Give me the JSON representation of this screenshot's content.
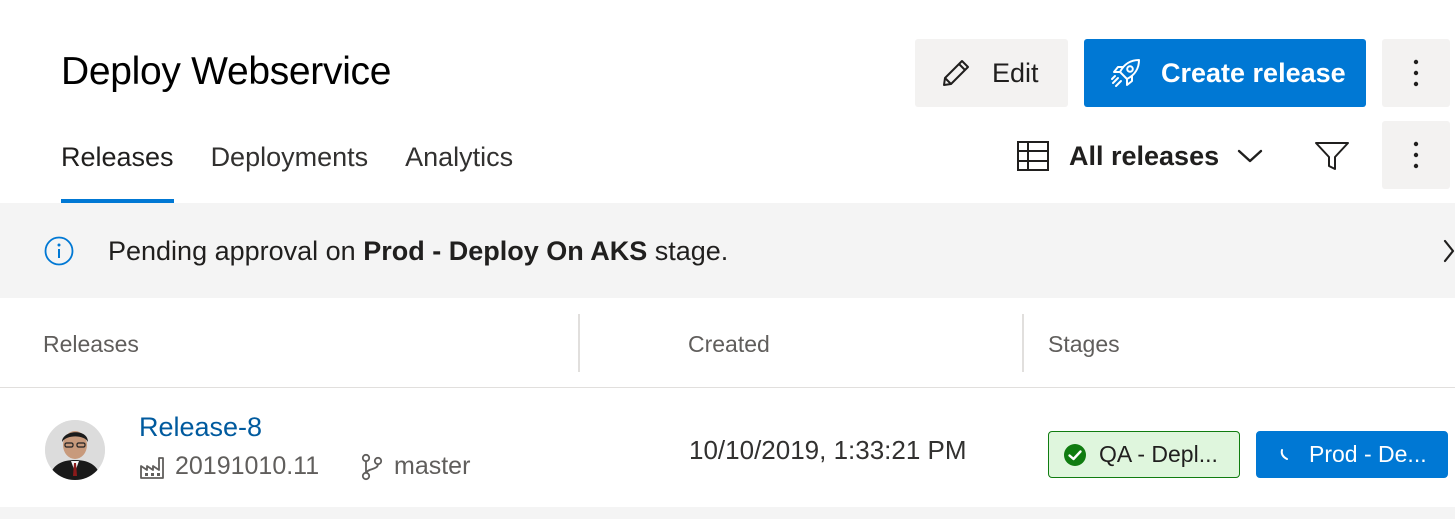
{
  "header": {
    "title": "Deploy Webservice",
    "edit_label": "Edit",
    "create_release_label": "Create release"
  },
  "tabs": [
    {
      "label": "Releases",
      "active": true
    },
    {
      "label": "Deployments",
      "active": false
    },
    {
      "label": "Analytics",
      "active": false
    }
  ],
  "toolbar": {
    "view_label": "All releases"
  },
  "banner": {
    "prefix": "Pending approval on ",
    "stage_name": "Prod - Deploy On AKS",
    "suffix": " stage."
  },
  "table": {
    "columns": [
      "Releases",
      "Created",
      "Stages"
    ],
    "rows": [
      {
        "release": "Release-8",
        "build": "20191010.11",
        "branch": "master",
        "created": "10/10/2019, 1:33:21 PM",
        "stages": [
          {
            "label": "QA - Depl...",
            "status": "succeeded"
          },
          {
            "label": "Prod - De...",
            "status": "in-progress"
          }
        ]
      }
    ]
  },
  "icons": {
    "edit": "pencil-icon",
    "create": "rocket-icon",
    "more": "more-vertical-icon",
    "view": "grid-view-icon",
    "chevron": "chevron-down-icon",
    "filter": "filter-icon",
    "info": "info-icon",
    "close": "chevron-right-icon",
    "build": "build-icon",
    "branch": "branch-icon",
    "success": "check-circle-icon",
    "progress": "spinner-icon"
  },
  "colors": {
    "accent": "#0078d4",
    "link": "#005a9e",
    "success_bg": "#dff6dd",
    "success_border": "#107c10",
    "success_check": "#107c10"
  }
}
